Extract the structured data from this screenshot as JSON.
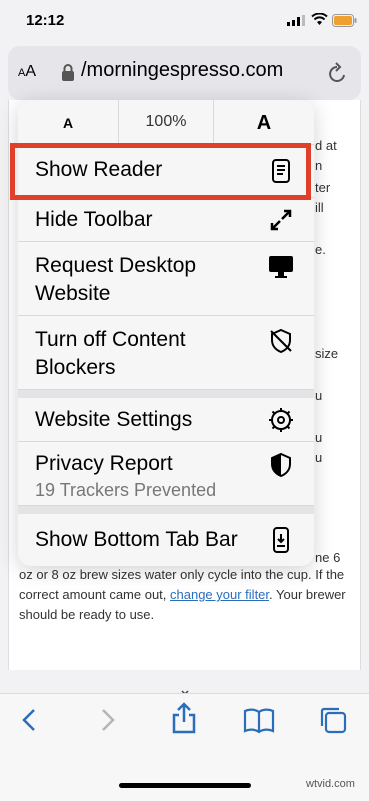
{
  "status": {
    "time": "12:12"
  },
  "urlbar": {
    "aa_small": "A",
    "aa_large": "A",
    "url": "/morningespresso.com"
  },
  "page_fragments": [
    "d at",
    "n",
    "ter",
    "ill",
    "e.",
    "size",
    "u",
    "u",
    "u",
    "ne 6"
  ],
  "page_bottom": {
    "text1": "oz or 8 oz brew sizes water only cycle into the cup. If the correct amount came out, ",
    "link": "change your filter",
    "text2": ". Your brewer should be ready to use."
  },
  "menu": {
    "size_small": "A",
    "zoom": "100%",
    "size_large": "A",
    "items": [
      {
        "label": "Show Reader",
        "icon": "reader-icon"
      },
      {
        "label": "Hide Toolbar",
        "icon": "resize-arrows-icon"
      },
      {
        "label": "Request Desktop Website",
        "icon": "desktop-icon"
      },
      {
        "label": "Turn off Content Blockers",
        "icon": "shield-slash-icon"
      },
      {
        "label": "Website Settings",
        "icon": "gear-icon"
      },
      {
        "label": "Privacy Report",
        "sub": "19 Trackers Prevented",
        "icon": "privacy-shield-icon"
      },
      {
        "label": "Show Bottom Tab Bar",
        "icon": "phone-tabbar-icon"
      }
    ]
  },
  "highlight_color": "#e0402a",
  "watermark": "wtvid.com"
}
